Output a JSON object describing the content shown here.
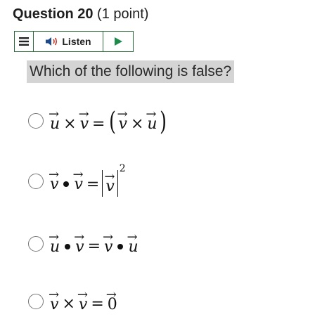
{
  "question": {
    "title": "Question 20",
    "points": "(1 point)",
    "text": "Which of the following is false?"
  },
  "toolbar": {
    "menu_icon": "hamburger-icon",
    "listen_icon": "speaker-icon",
    "listen_label": "Listen",
    "play_icon": "play-icon",
    "accent_color": "#2d6a3e",
    "play_color": "#1e8a4c"
  },
  "options": {
    "items": [
      {
        "id": "a",
        "selected": false
      },
      {
        "id": "b",
        "selected": false
      },
      {
        "id": "c",
        "selected": false
      },
      {
        "id": "d",
        "selected": false
      }
    ],
    "sym": {
      "u": "u",
      "v": "v",
      "cross": "×",
      "equals": "=",
      "lparen": "(",
      "rparen": ")",
      "arrow": "→",
      "two": "2",
      "zero": "0"
    }
  }
}
